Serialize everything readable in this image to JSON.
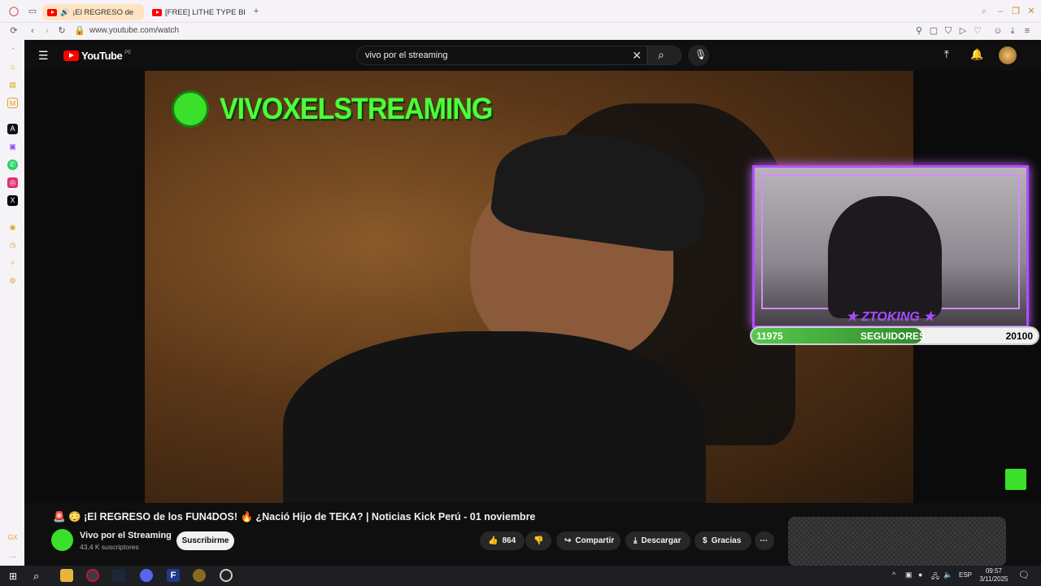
{
  "browser": {
    "tabs": [
      {
        "label": "¡El REGRESO de"
      },
      {
        "label": "[FREE] LITHE TYPE BEAT"
      }
    ],
    "url": "www.youtube.com/watch"
  },
  "youtube": {
    "logo": "YouTube",
    "region": "PE",
    "search_value": "vivo por el streaming"
  },
  "video": {
    "stream_title": "VIVOXELSTREAMING",
    "cam_name": "ZTOKING",
    "followers": {
      "current": "11975",
      "label": "SEGUIDORES",
      "goal": "20100",
      "progress": 0.596
    },
    "title": "¡El REGRESO de los FUN4DOS! 🔥 ¿Nació Hijo de TEKA? | Noticias Kick Perú - 01 noviembre",
    "title_prefix": "🚨 😳"
  },
  "channel": {
    "name": "Vivo por el Streaming",
    "subscribers": "43,4 K suscriptores",
    "subscribe_label": "Suscribirme"
  },
  "actions": {
    "likes": "864",
    "share": "Compartir",
    "download": "Descargar",
    "thanks": "Gracias"
  },
  "taskbar": {
    "lang": "ESP",
    "time": "09:57",
    "date": "3/11/2025"
  },
  "colors": {
    "accent_green": "#4dff3a",
    "frame_purple": "#b44dff",
    "yt_red": "#ff0000"
  }
}
